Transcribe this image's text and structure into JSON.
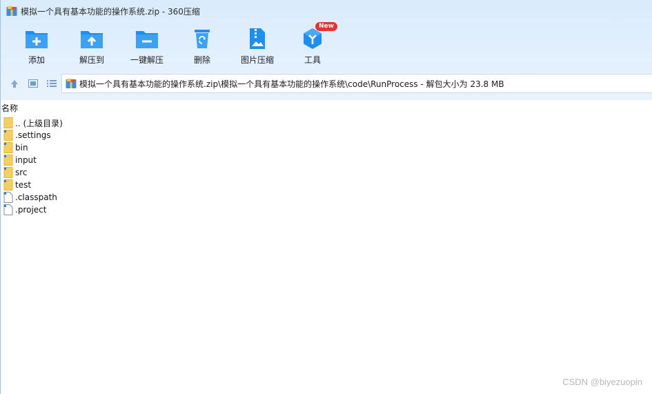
{
  "window": {
    "title": "模拟一个具有基本功能的操作系统.zip - 360压缩"
  },
  "toolbar": {
    "items": [
      {
        "label": "添加",
        "icon": "add-folder-icon"
      },
      {
        "label": "解压到",
        "icon": "extract-to-icon"
      },
      {
        "label": "一键解压",
        "icon": "one-click-extract-icon"
      },
      {
        "label": "删除",
        "icon": "recycle-bin-icon"
      },
      {
        "label": "图片压缩",
        "icon": "image-compress-icon"
      },
      {
        "label": "工具",
        "icon": "tools-icon",
        "badge": "New"
      }
    ]
  },
  "nav": {
    "path": "模拟一个具有基本功能的操作系统.zip\\模拟一个具有基本功能的操作系统\\code\\RunProcess - 解包大小为 23.8 MB"
  },
  "list": {
    "column_name": "名称",
    "files": [
      {
        "name": ".. (上级目录)",
        "type": "folder"
      },
      {
        "name": ".settings",
        "type": "folder"
      },
      {
        "name": "bin",
        "type": "folder"
      },
      {
        "name": "input",
        "type": "folder"
      },
      {
        "name": "src",
        "type": "folder"
      },
      {
        "name": "test",
        "type": "folder"
      },
      {
        "name": ".classpath",
        "type": "file"
      },
      {
        "name": ".project",
        "type": "file"
      }
    ]
  },
  "watermark": "CSDN @biyezuopin",
  "colors": {
    "accent_blue": "#1e8ff0",
    "folder_yellow": "#f7cf5b",
    "badge_red": "#e8322d"
  }
}
